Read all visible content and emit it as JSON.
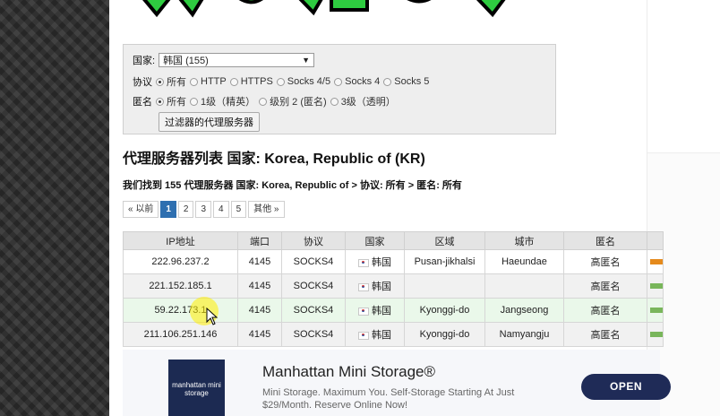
{
  "filter": {
    "country_label": "国家:",
    "country_value": "韩国 (155)",
    "protocol_label": "协议",
    "protocol_options": [
      "所有",
      "HTTP",
      "HTTPS",
      "Socks 4/5",
      "Socks 4",
      "Socks 5"
    ],
    "anonymity_label": "匿名",
    "anonymity_options": [
      "所有",
      "1级（精英）",
      "级别 2 (匿名)",
      "3级（透明）"
    ],
    "submit_label": "过滤器的代理服务器"
  },
  "heading": "代理服务器列表 国家: Korea, Republic of (KR)",
  "found_text": "我们找到 155 代理服务器 国家: Korea, Republic of > 协议: 所有 > 匿名: 所有",
  "pagination": {
    "prev": "« 以前",
    "pages": [
      "1",
      "2",
      "3",
      "4",
      "5"
    ],
    "more": "其他 »"
  },
  "table": {
    "headers": [
      "IP地址",
      "端口",
      "协议",
      "国家",
      "区域",
      "城市",
      "匿名"
    ],
    "rows": [
      {
        "ip": "222.96.237.2",
        "port": "4145",
        "protocol": "SOCKS4",
        "country": "韩国",
        "region": "Pusan-jikhalsi",
        "city": "Haeundae",
        "anonymity": "高匿名",
        "speed_color": "#e58a1c"
      },
      {
        "ip": "221.152.185.1",
        "port": "4145",
        "protocol": "SOCKS4",
        "country": "韩国",
        "region": "",
        "city": "",
        "anonymity": "高匿名",
        "speed_color": "#79b65b"
      },
      {
        "ip": "59.22.173.1",
        "port": "4145",
        "protocol": "SOCKS4",
        "country": "韩国",
        "region": "Kyonggi-do",
        "city": "Jangseong",
        "anonymity": "高匿名",
        "speed_color": "#79b65b"
      },
      {
        "ip": "211.106.251.146",
        "port": "4145",
        "protocol": "SOCKS4",
        "country": "韩国",
        "region": "Kyonggi-do",
        "city": "Namyangju",
        "anonymity": "高匿名",
        "speed_color": "#79b65b"
      }
    ]
  },
  "ad": {
    "logo_text": "manhattan mini storage",
    "title": "Manhattan Mini Storage®",
    "description": "Mini Storage. Maximum You. Self-Storage Starting At Just $29/Month. Reserve Online Now!",
    "cta": "OPEN"
  }
}
